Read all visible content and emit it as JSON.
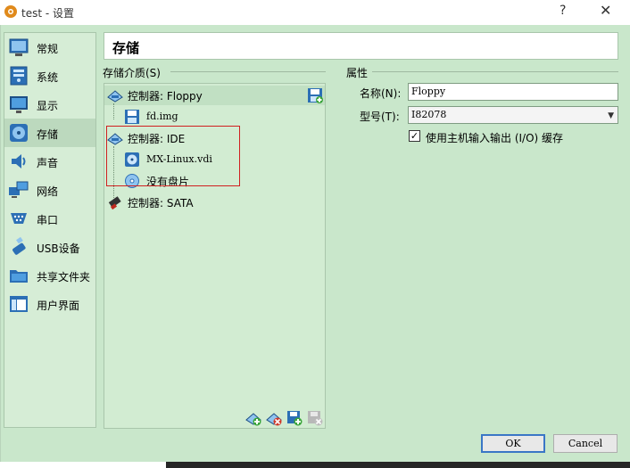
{
  "window": {
    "title": "test - 设置",
    "help_glyph": "?",
    "close_glyph": "✕"
  },
  "nav": {
    "items": [
      {
        "label": "常规",
        "icon": "general-icon"
      },
      {
        "label": "系统",
        "icon": "system-icon"
      },
      {
        "label": "显示",
        "icon": "display-icon"
      },
      {
        "label": "存储",
        "icon": "storage-icon",
        "active": true
      },
      {
        "label": "声音",
        "icon": "audio-icon"
      },
      {
        "label": "网络",
        "icon": "network-icon"
      },
      {
        "label": "串口",
        "icon": "serial-port-icon"
      },
      {
        "label": "USB设备",
        "icon": "usb-icon"
      },
      {
        "label": "共享文件夹",
        "icon": "shared-folder-icon"
      },
      {
        "label": "用户界面",
        "icon": "user-interface-icon"
      }
    ]
  },
  "section_title": "存储",
  "storage": {
    "group_label": "存储介质(S)",
    "tree": [
      {
        "label": "控制器: Floppy",
        "icon": "floppy-controller-icon"
      },
      {
        "label": "fd.img",
        "icon": "floppy-disk-icon"
      },
      {
        "label": "控制器: IDE",
        "icon": "ide-controller-icon"
      },
      {
        "label": "MX-Linux.vdi",
        "icon": "hard-disk-icon"
      },
      {
        "label": "没有盘片",
        "icon": "optical-disc-icon"
      },
      {
        "label": "控制器: SATA",
        "icon": "sata-controller-icon"
      }
    ]
  },
  "attributes": {
    "group_label": "属性",
    "name_label": "名称(N):",
    "name_value": "Floppy",
    "type_label": "型号(T):",
    "type_value": "I82078",
    "host_cache_label": "使用主机输入输出 (I/O) 缓存",
    "host_cache_checked": "✓"
  },
  "buttons": {
    "ok": "OK",
    "cancel": "Cancel"
  },
  "colors": {
    "accent_border": "#3a76c6",
    "highlight_box": "#d02020",
    "panel_green": "#c9e7cb"
  }
}
